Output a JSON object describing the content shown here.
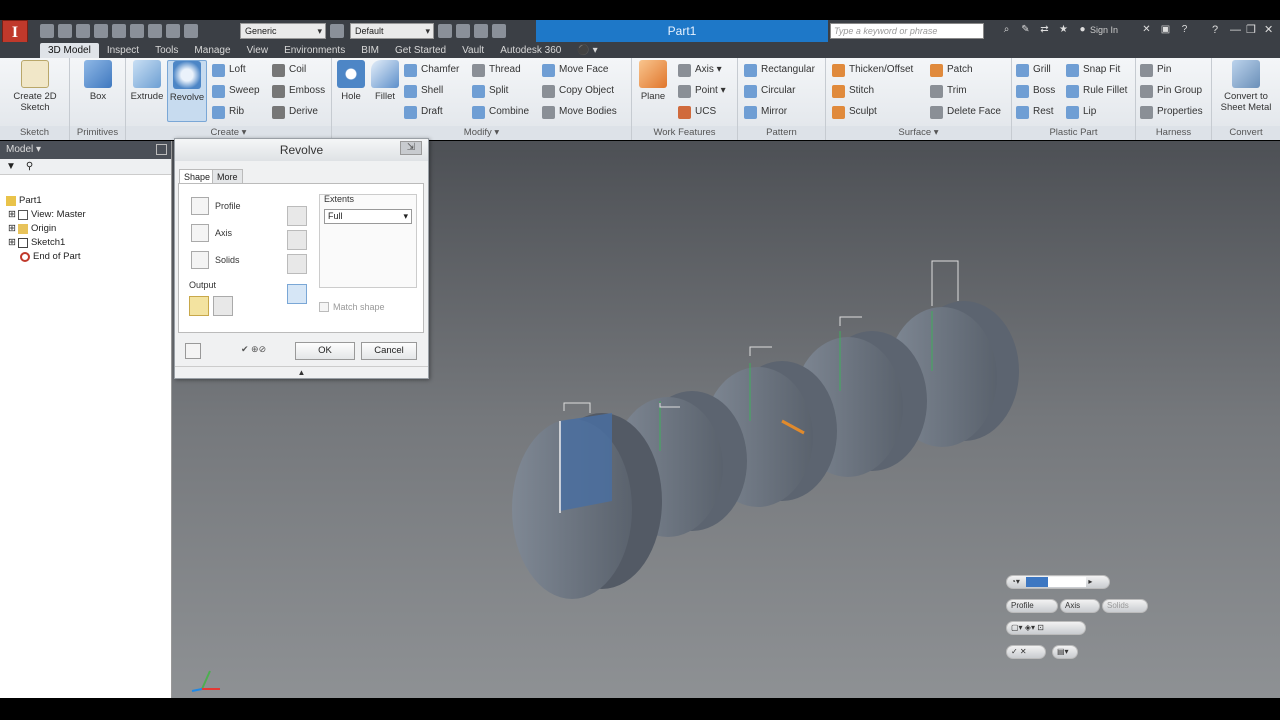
{
  "app": {
    "logo": "I",
    "document_title": "Part1",
    "search_placeholder": "Type a keyword or phrase",
    "sign_in": "Sign In",
    "material": "Generic",
    "appearance": "Default"
  },
  "tabs": [
    "3D Model",
    "Inspect",
    "Tools",
    "Manage",
    "View",
    "Environments",
    "BIM",
    "Get Started",
    "Vault",
    "Autodesk 360"
  ],
  "ribbon": {
    "sketch": {
      "title": "Sketch",
      "create_sketch": "Create 2D Sketch"
    },
    "primitives": {
      "title": "Primitives",
      "box": "Box"
    },
    "create": {
      "title": "Create",
      "extrude": "Extrude",
      "revolve": "Revolve",
      "loft": "Loft",
      "sweep": "Sweep",
      "rib": "Rib",
      "coil": "Coil",
      "emboss": "Emboss",
      "derive": "Derive"
    },
    "modify": {
      "title": "Modify",
      "hole": "Hole",
      "fillet": "Fillet",
      "chamfer": "Chamfer",
      "shell": "Shell",
      "draft": "Draft",
      "thread": "Thread",
      "split": "Split",
      "combine": "Combine",
      "move_face": "Move Face",
      "copy_object": "Copy Object",
      "move_bodies": "Move Bodies"
    },
    "work_features": {
      "title": "Work Features",
      "plane": "Plane",
      "axis": "Axis",
      "point": "Point",
      "ucs": "UCS"
    },
    "pattern": {
      "title": "Pattern",
      "rectangular": "Rectangular",
      "circular": "Circular",
      "mirror": "Mirror"
    },
    "surface": {
      "title": "Surface",
      "thicken_offset": "Thicken/Offset",
      "stitch": "Stitch",
      "sculpt": "Sculpt",
      "patch": "Patch",
      "trim": "Trim",
      "delete_face": "Delete Face"
    },
    "plastic_part": {
      "title": "Plastic Part",
      "grill": "Grill",
      "boss": "Boss",
      "rest": "Rest",
      "snap_fit": "Snap Fit",
      "rule_fillet": "Rule Fillet",
      "lip": "Lip"
    },
    "harness": {
      "title": "Harness",
      "pin": "Pin",
      "pin_group": "Pin Group",
      "properties": "Properties"
    },
    "convert": {
      "title": "Convert",
      "convert_sheet_metal": "Convert to Sheet Metal"
    }
  },
  "browser": {
    "header": "Model ▾",
    "nodes": [
      "Part1",
      "View: Master",
      "Origin",
      "Sketch1",
      "End of Part"
    ]
  },
  "dialog": {
    "title": "Revolve",
    "tabs": [
      "Shape",
      "More"
    ],
    "profile": "Profile",
    "axis": "Axis",
    "solids": "Solids",
    "output": "Output",
    "extents_label": "Extents",
    "extents_value": "Full",
    "match_shape": "Match shape",
    "ok": "OK",
    "cancel": "Cancel"
  },
  "minitoolbar": {
    "profile": "Profile",
    "axis": "Axis",
    "solids": "Solids"
  },
  "colors": {
    "title_blue": "#1e78c8",
    "ribbon_bg": "#e6e9ed",
    "part_gray": "#6e7580",
    "profile_blue": "#4a6fa0"
  }
}
